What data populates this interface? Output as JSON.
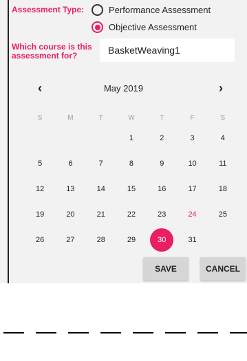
{
  "form": {
    "assessment_type_label": "Assessment Type:",
    "options": [
      {
        "label": "Performance Assessment",
        "selected": false
      },
      {
        "label": "Objective Assessment",
        "selected": true
      }
    ],
    "course_label_line1": "Which course is this",
    "course_label_line2": "assessment for?",
    "course_value": "BasketWeaving1"
  },
  "calendar": {
    "prev_icon": "chevron-left-icon",
    "next_icon": "chevron-right-icon",
    "prev_glyph": "‹",
    "next_glyph": "›",
    "month_label": "May 2019",
    "weekdays": [
      "S",
      "M",
      "T",
      "W",
      "T",
      "F",
      "S"
    ],
    "leading_blanks": 3,
    "days": [
      "1",
      "2",
      "3",
      "4",
      "5",
      "6",
      "7",
      "8",
      "9",
      "10",
      "11",
      "12",
      "13",
      "14",
      "15",
      "16",
      "17",
      "18",
      "19",
      "20",
      "21",
      "22",
      "23",
      "24",
      "25",
      "26",
      "27",
      "28",
      "29",
      "30",
      "31"
    ],
    "today_day": "24",
    "selected_day": "30"
  },
  "actions": {
    "save_label": "SAVE",
    "cancel_label": "CANCEL"
  },
  "colors": {
    "accent": "#e91e63",
    "panel_bg": "#f2f2f2",
    "button_bg": "#d6d6d6"
  }
}
